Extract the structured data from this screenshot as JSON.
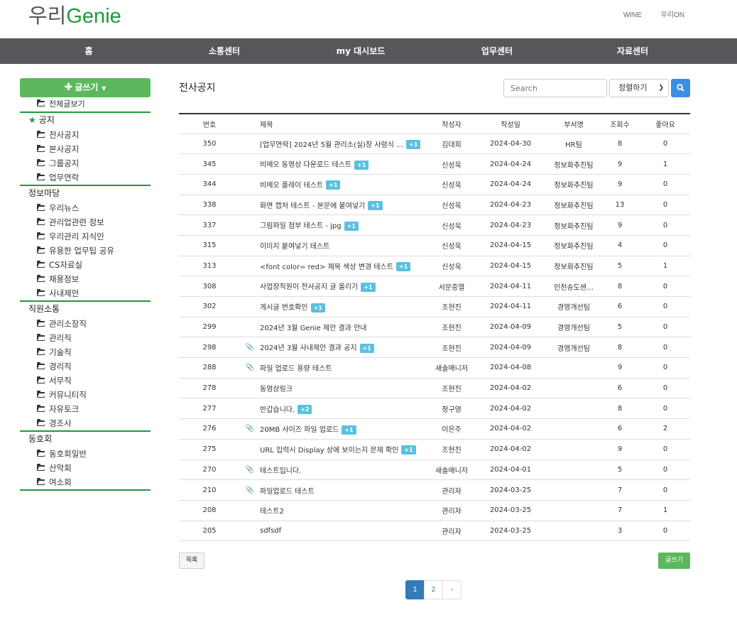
{
  "header": {
    "logo_part1": "우리",
    "logo_part2": "Genie",
    "links": [
      "WINE",
      "우리ON"
    ]
  },
  "nav": [
    "홈",
    "소통센터",
    "my 대시보드",
    "업무센터",
    "자료센터"
  ],
  "sidebar": {
    "write_label": "글쓰기",
    "all_label": "전체글보기",
    "sections": [
      {
        "title": "공지",
        "starred": true,
        "items": [
          "전사공지",
          "본사공지",
          "그룹공지",
          "업무연락"
        ]
      },
      {
        "title": "정보마당",
        "starred": false,
        "items": [
          "우리뉴스",
          "관리업관련 정보",
          "우리관리 지식인",
          "유용한 업무팁 공유",
          "CS자료실",
          "채용정보",
          "사내제안"
        ]
      },
      {
        "title": "직원소통",
        "starred": false,
        "items": [
          "관리소장직",
          "관리직",
          "기술직",
          "경리직",
          "서무직",
          "커뮤니티직",
          "자유토크",
          "경조사"
        ]
      },
      {
        "title": "동호회",
        "starred": false,
        "items": [
          "동호회일반",
          "산악회",
          "여소회"
        ]
      }
    ]
  },
  "main": {
    "title": "전사공지",
    "search_placeholder": "Search",
    "sort_label": "정렬하기",
    "columns": [
      "번호",
      "제목",
      "작성자",
      "작성일",
      "부서명",
      "조회수",
      "좋아요"
    ],
    "rows": [
      {
        "num": "350",
        "clip": false,
        "title": "[업무연락] 2024년 5월 관리소(실)장 사령식 …",
        "badge": "+1",
        "author": "김대희",
        "date": "2024-04-30",
        "dept": "HR팀",
        "views": "8",
        "likes": "0"
      },
      {
        "num": "345",
        "clip": false,
        "title": "비메오 동영상 다운로드 테스트",
        "badge": "+1",
        "author": "신성욱",
        "date": "2024-04-24",
        "dept": "정보화추진팀",
        "views": "9",
        "likes": "1"
      },
      {
        "num": "344",
        "clip": false,
        "title": "비메오 플레이 테스트",
        "badge": "+1",
        "author": "신성욱",
        "date": "2024-04-24",
        "dept": "정보화추진팀",
        "views": "9",
        "likes": "0"
      },
      {
        "num": "338",
        "clip": false,
        "title": "화면 캡처 테스트 - 본문에 붙여넣기",
        "badge": "+1",
        "author": "신성욱",
        "date": "2024-04-23",
        "dept": "정보화추진팀",
        "views": "13",
        "likes": "0"
      },
      {
        "num": "337",
        "clip": false,
        "title": "그림파일 첨부 테스트 - jpg",
        "badge": "+1",
        "author": "신성욱",
        "date": "2024-04-23",
        "dept": "정보화추진팀",
        "views": "9",
        "likes": "0"
      },
      {
        "num": "315",
        "clip": false,
        "title": "이미지 붙여넣기 테스트",
        "badge": "",
        "author": "신성욱",
        "date": "2024-04-15",
        "dept": "정보화추진팀",
        "views": "4",
        "likes": "0"
      },
      {
        "num": "313",
        "clip": false,
        "title": "<font color= red> 제목 색상 변경 테스트",
        "badge": "+1",
        "author": "신성욱",
        "date": "2024-04-15",
        "dept": "정보화추진팀",
        "views": "5",
        "likes": "1"
      },
      {
        "num": "308",
        "clip": false,
        "title": "사업장직원이 전사공지 글 올리기",
        "badge": "+1",
        "author": "서문중열",
        "date": "2024-04-11",
        "dept": "인천송도센…",
        "views": "8",
        "likes": "0"
      },
      {
        "num": "302",
        "clip": false,
        "title": "게시글 번호확인",
        "badge": "+1",
        "author": "조현진",
        "date": "2024-04-11",
        "dept": "경영개선팀",
        "views": "6",
        "likes": "0"
      },
      {
        "num": "299",
        "clip": false,
        "title": "2024년 3월 Genie 제안 결과 안내",
        "badge": "",
        "author": "조현진",
        "date": "2024-04-09",
        "dept": "경영개선팀",
        "views": "5",
        "likes": "0"
      },
      {
        "num": "298",
        "clip": true,
        "title": "2024년 3월 사내제안 결과 공지",
        "badge": "+1",
        "author": "조현진",
        "date": "2024-04-09",
        "dept": "경영개선팀",
        "views": "8",
        "likes": "0"
      },
      {
        "num": "288",
        "clip": true,
        "title": "파일 업로드 용량 테스트",
        "badge": "",
        "author": "새솔매니저",
        "date": "2024-04-08",
        "dept": "",
        "views": "9",
        "likes": "0"
      },
      {
        "num": "278",
        "clip": false,
        "title": "동영상링크",
        "badge": "",
        "author": "조현진",
        "date": "2024-04-02",
        "dept": "",
        "views": "6",
        "likes": "0"
      },
      {
        "num": "277",
        "clip": false,
        "title": "반갑습니다.",
        "badge": "+2",
        "author": "정구영",
        "date": "2024-04-02",
        "dept": "",
        "views": "8",
        "likes": "0"
      },
      {
        "num": "276",
        "clip": true,
        "title": "20MB 사이즈 파일 업로드",
        "badge": "+1",
        "author": "이은주",
        "date": "2024-04-02",
        "dept": "",
        "views": "6",
        "likes": "2"
      },
      {
        "num": "275",
        "clip": false,
        "title": "URL 입력시 Display 상에 보이는지 문제 확인",
        "badge": "+1",
        "author": "조현진",
        "date": "2024-04-02",
        "dept": "",
        "views": "9",
        "likes": "0"
      },
      {
        "num": "270",
        "clip": true,
        "title": "테스트입니다.",
        "badge": "",
        "author": "새솔매니저",
        "date": "2024-04-01",
        "dept": "",
        "views": "5",
        "likes": "0"
      },
      {
        "num": "210",
        "clip": true,
        "title": "파일업로드 테스트",
        "badge": "",
        "author": "관리자",
        "date": "2024-03-25",
        "dept": "",
        "views": "7",
        "likes": "0"
      },
      {
        "num": "208",
        "clip": false,
        "title": "테스트2",
        "badge": "",
        "author": "관리자",
        "date": "2024-03-25",
        "dept": "",
        "views": "7",
        "likes": "1"
      },
      {
        "num": "205",
        "clip": false,
        "title": "sdfsdf",
        "badge": "",
        "author": "관리자",
        "date": "2024-03-25",
        "dept": "",
        "views": "3",
        "likes": "0"
      }
    ],
    "list_label": "목록",
    "write_label": "글쓰기",
    "pages": [
      "1",
      "2"
    ],
    "next_label": "›"
  },
  "colors": {
    "accent_green": "#1e9a3b",
    "button_green": "#5cb85c",
    "navbar": "#56575a",
    "badge": "#5bc0de",
    "primary_blue": "#337ab7"
  }
}
